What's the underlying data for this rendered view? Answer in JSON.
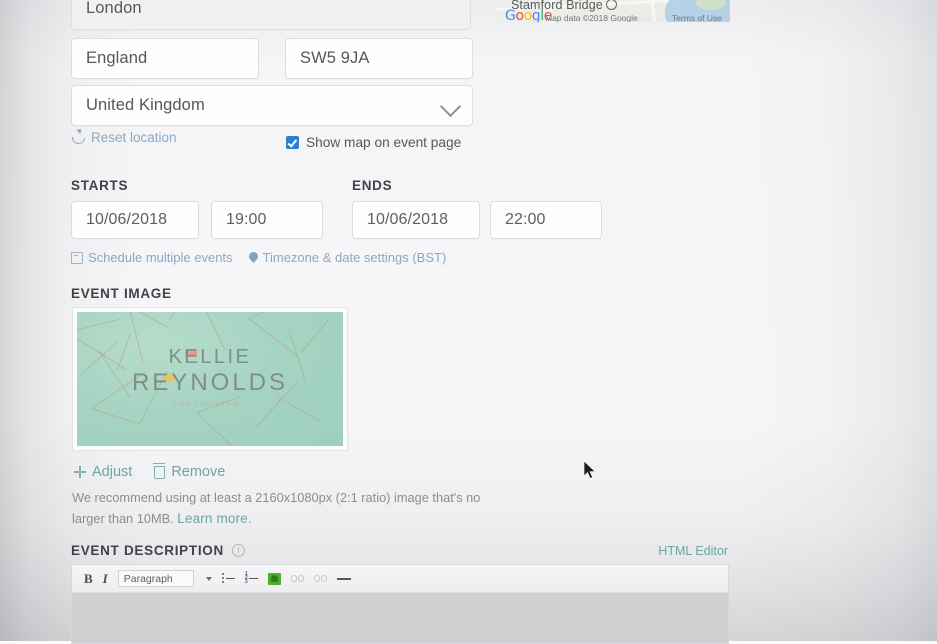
{
  "address": {
    "city": "London",
    "region": "England",
    "postcode": "SW5 9JA",
    "country": "United Kingdom",
    "reset_location_label": "Reset location",
    "show_map_label": "Show map on event page",
    "show_map_checked": true
  },
  "map": {
    "place_label": "Stamford Bridge",
    "logo_letters": [
      "G",
      "o",
      "o",
      "g",
      "l",
      "e"
    ],
    "attribution": "Map data ©2018 Google",
    "terms": "Terms of Use"
  },
  "schedule": {
    "starts_label": "STARTS",
    "ends_label": "ENDS",
    "starts_date": "10/06/2018",
    "starts_time": "19:00",
    "ends_date": "10/06/2018",
    "ends_time": "22:00",
    "multiple_events_link": "Schedule multiple events",
    "timezone_link": "Timezone & date settings (BST)"
  },
  "event_image": {
    "label": "EVENT IMAGE",
    "poster_title_line1": "KELLIE",
    "poster_title_line2": "REYNOLDS",
    "poster_subtitle": "PHOTOGRAPHY",
    "adjust_label": "Adjust",
    "remove_label": "Remove",
    "hint_text": "We recommend using at least a 2160x1080px (2:1 ratio) image that's no larger than 10MB. ",
    "hint_link": "Learn more",
    "hint_period": "."
  },
  "event_description": {
    "label": "EVENT DESCRIPTION",
    "info_glyph": "i",
    "html_editor_link": "HTML Editor",
    "toolbar": {
      "bold": "B",
      "italic": "I",
      "paragraph_style": "Paragraph"
    },
    "body_value": ""
  },
  "colors": {
    "link_teal": "#6aa79f",
    "link_blue": "#8aa8c2",
    "checkbox_blue": "#2d7fd5",
    "label_dark": "#3f4246",
    "poster_mint": "#a6d4c4",
    "poster_gold": "#ba9c74",
    "accent_pink": "#eb8c82",
    "accent_yellow": "#e8c45a"
  }
}
